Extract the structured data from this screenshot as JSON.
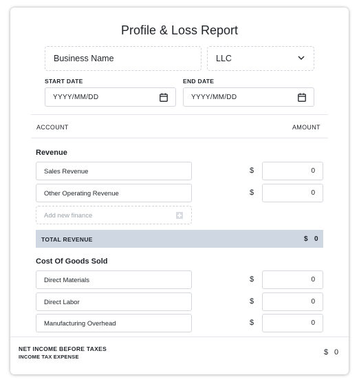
{
  "report": {
    "title": "Profile & Loss  Report",
    "business_name_placeholder": "Business Name",
    "entity_type": "LLC",
    "start_date": {
      "label": "START DATE",
      "placeholder": "YYYY/MM/DD"
    },
    "end_date": {
      "label": "END DATE",
      "placeholder": "YYYY/MM/DD"
    }
  },
  "table": {
    "account_header": "ACCOUNT",
    "amount_header": "AMOUNT"
  },
  "revenue": {
    "title": "Revenue",
    "currency": "$",
    "rows": [
      {
        "account": "Sales Revenue",
        "amount": "0"
      },
      {
        "account": "Other Operating Revenue",
        "amount": "0"
      }
    ],
    "add_placeholder": "Add new finance",
    "total_label": "TOTAL REVENUE",
    "total_currency": "$",
    "total_value": "0"
  },
  "cogs": {
    "title": "Cost Of Goods Sold",
    "currency": "$",
    "rows": [
      {
        "account": "Direct Materials",
        "amount": "0"
      },
      {
        "account": "Direct Labor",
        "amount": "0"
      },
      {
        "account": "Manufacturing Overhead",
        "amount": "0"
      }
    ]
  },
  "footer": {
    "net_income_label": "NET INCOME BEFORE TAXES",
    "tax_label": "INCOME TAX EXPENSE",
    "currency": "$",
    "value": "0"
  },
  "icons": {
    "dropdown": "chevron-down-icon",
    "date": "calendar-icon",
    "add": "plus-icon"
  }
}
